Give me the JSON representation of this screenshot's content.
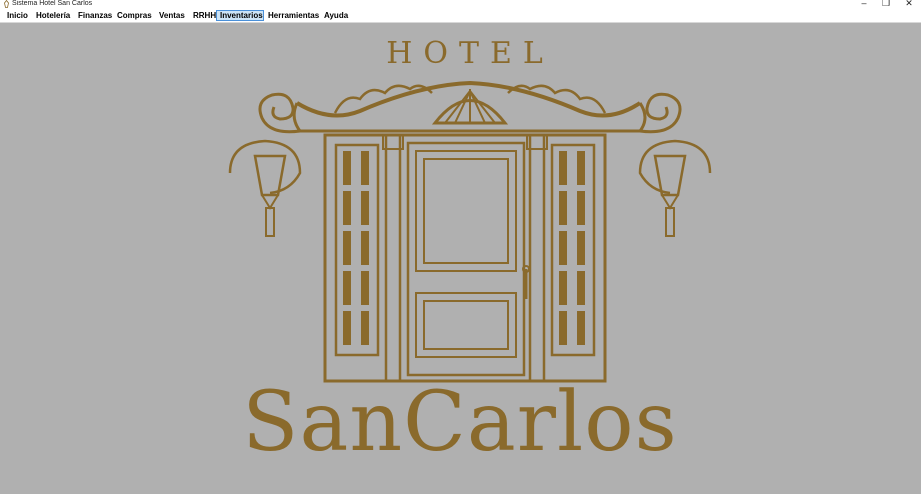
{
  "window": {
    "title": "Sistema Hotel San Carlos",
    "controls": {
      "minimize": "–",
      "restore": "❐",
      "close": "✕"
    }
  },
  "menu": {
    "items": [
      "Inicio",
      "Hotelería",
      "Finanzas",
      "Compras",
      "Ventas",
      "RRHH",
      "Inventarios",
      "Herramientas",
      "Ayuda"
    ],
    "active": "Inventarios"
  },
  "logo": {
    "top_text": "HOTEL",
    "brand_text": "SanCarlos",
    "color": "#8a6a2c",
    "background": "#b0b0b0"
  }
}
